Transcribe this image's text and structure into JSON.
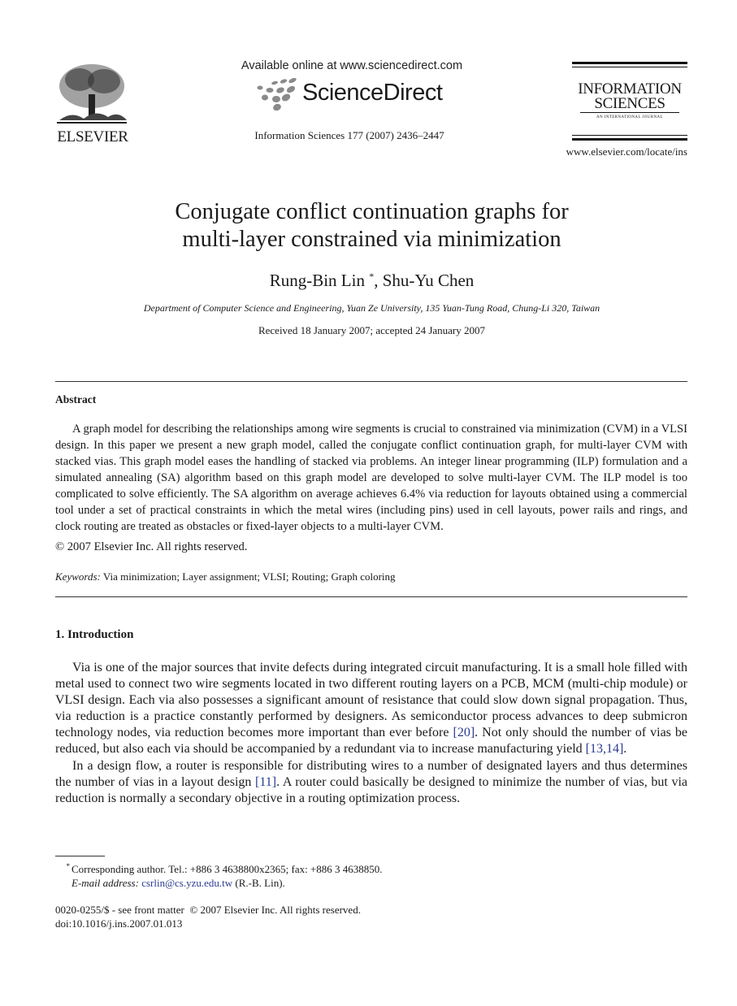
{
  "header": {
    "publisher_logo_text": "ELSEVIER",
    "available_online": "Available online at www.sciencedirect.com",
    "sciencedirect_wordmark": "ScienceDirect",
    "journal_citation": "Information Sciences 177 (2007) 2436–2447",
    "journal_logo": {
      "line1": "INFORMATION",
      "line2": "SCIENCES",
      "subtitle": "AN INTERNATIONAL JOURNAL"
    },
    "journal_url": "www.elsevier.com/locate/ins"
  },
  "article": {
    "title_line1": "Conjugate conflict continuation graphs for",
    "title_line2": "multi-layer constrained via minimization",
    "author1": "Rung-Bin Lin",
    "author1_mark": "*",
    "author_separator": ", ",
    "author2": "Shu-Yu Chen",
    "affiliation": "Department of Computer Science and Engineering, Yuan Ze University, 135 Yuan-Tung Road, Chung-Li 320, Taiwan",
    "received": "Received 18 January 2007; accepted 24 January 2007"
  },
  "abstract": {
    "heading": "Abstract",
    "text": "A graph model for describing the relationships among wire segments is crucial to constrained via minimization (CVM) in a VLSI design. In this paper we present a new graph model, called the conjugate conflict continuation graph, for multi-layer CVM with stacked vias. This graph model eases the handling of stacked via problems. An integer linear programming (ILP) formulation and a simulated annealing (SA) algorithm based on this graph model are developed to solve multi-layer CVM. The ILP model is too complicated to solve efficiently. The SA algorithm on average achieves 6.4% via reduction for layouts obtained using a commercial tool under a set of practical constraints in which the metal wires (including pins) used in cell layouts, power rails and rings, and clock routing are treated as obstacles or fixed-layer objects to a multi-layer CVM.",
    "copyright": "© 2007 Elsevier Inc. All rights reserved.",
    "keywords_label": "Keywords:",
    "keywords": "Via minimization; Layer assignment; VLSI; Routing; Graph coloring"
  },
  "introduction": {
    "heading": "1. Introduction",
    "p1_a": "Via is one of the major sources that invite defects during integrated circuit manufacturing. It is a small hole filled with metal used to connect two wire segments located in two different routing layers on a PCB, MCM (multi-chip module) or VLSI design. Each via also possesses a significant amount of resistance that could slow down signal propagation. Thus, via reduction is a practice constantly performed by designers. As semiconductor process advances to deep submicron technology nodes, via reduction becomes more important than ever before ",
    "p1_cite1": "[20]",
    "p1_b": ". Not only should the number of vias be reduced, but also each via should be accompanied by a redundant via to increase manufacturing yield ",
    "p1_cite2": "[13,14]",
    "p1_c": ".",
    "p2_a": "In a design flow, a router is responsible for distributing wires to a number of designated layers and thus determines the number of vias in a layout design ",
    "p2_cite1": "[11]",
    "p2_b": ". A router could basically be designed to minimize the number of vias, but via reduction is normally a secondary objective in a routing optimization process."
  },
  "footnote": {
    "mark": "*",
    "corresponding": "Corresponding author. Tel.: +886 3 4638800x2365; fax: +886 3 4638850.",
    "email_label": "E-mail address:",
    "email": "csrlin@cs.yzu.edu.tw",
    "email_suffix": " (R.-B. Lin).",
    "front_matter": "0020-0255/$ - see front matter  © 2007 Elsevier Inc. All rights reserved.",
    "doi": "doi:10.1016/j.ins.2007.01.013"
  },
  "colors": {
    "link": "#2a3a8f",
    "text": "#1a1a1a",
    "sd_dots": "#8a8a8a"
  }
}
